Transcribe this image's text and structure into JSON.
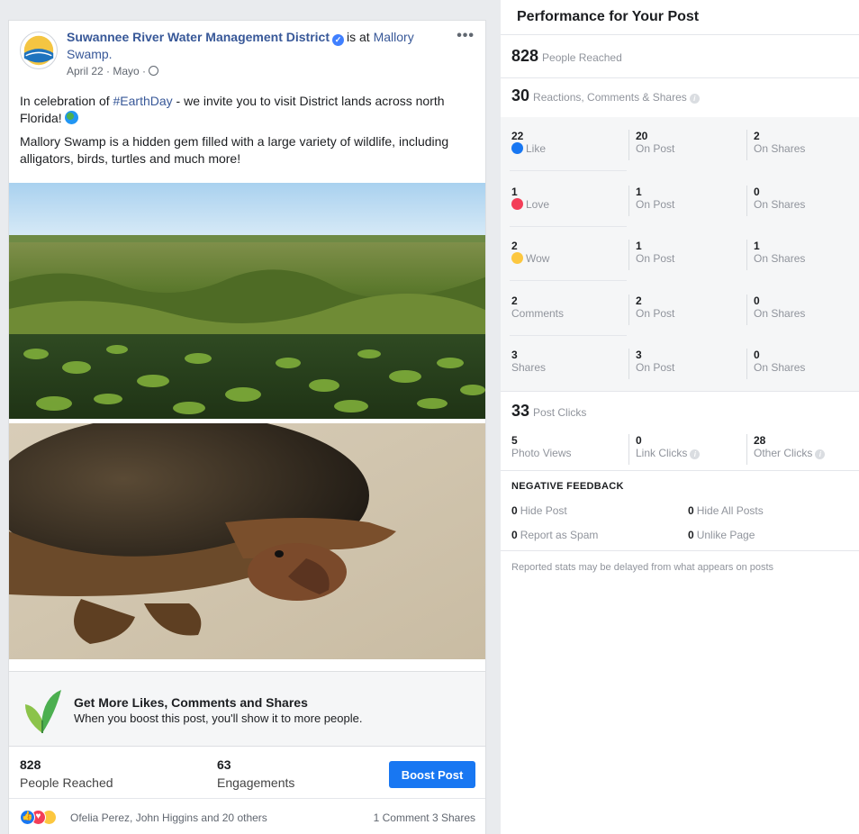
{
  "post": {
    "page_name": "Suwannee River Water Management District",
    "is_at": "is at",
    "location": "Mallory Swamp.",
    "date": "April 22",
    "author": "Mayo",
    "text_line1_prefix": "In celebration of ",
    "hashtag": "#EarthDay",
    "text_line1_suffix": " - we invite you to visit District lands across north Florida!",
    "text_line2": "Mallory Swamp is a hidden gem filled with a large variety of wildlife, including alligators, birds, turtles and much more!",
    "promo_title": "Get More Likes, Comments and Shares",
    "promo_sub": "When you boost this post, you'll show it to more people.",
    "people_reached_num": "828",
    "people_reached_lbl": "People Reached",
    "engagements_num": "63",
    "engagements_lbl": "Engagements",
    "boost_label": "Boost Post",
    "reaction_names": "Ofelia Perez, John Higgins and 20 others",
    "comments_shares": "1 Comment  3 Shares"
  },
  "performance": {
    "title": "Performance for Your Post",
    "reached_num": "828",
    "reached_lbl": "People Reached",
    "rcs_num": "30",
    "rcs_lbl": "Reactions, Comments & Shares",
    "rows": [
      {
        "total": "22",
        "label": "Like",
        "on_post": "20",
        "on_shares": "2"
      },
      {
        "total": "1",
        "label": "Love",
        "on_post": "1",
        "on_shares": "0"
      },
      {
        "total": "2",
        "label": "Wow",
        "on_post": "1",
        "on_shares": "1"
      },
      {
        "total": "2",
        "label": "Comments",
        "on_post": "2",
        "on_shares": "0"
      },
      {
        "total": "3",
        "label": "Shares",
        "on_post": "3",
        "on_shares": "0"
      }
    ],
    "on_post_lbl": "On Post",
    "on_shares_lbl": "On Shares",
    "clicks_num": "33",
    "clicks_lbl": "Post Clicks",
    "photo_views_num": "5",
    "photo_views_lbl": "Photo Views",
    "link_clicks_num": "0",
    "link_clicks_lbl": "Link Clicks",
    "other_clicks_num": "28",
    "other_clicks_lbl": "Other Clicks",
    "negative_title": "NEGATIVE FEEDBACK",
    "hide_post_num": "0",
    "hide_post_lbl": "Hide Post",
    "hide_all_num": "0",
    "hide_all_lbl": "Hide All Posts",
    "spam_num": "0",
    "spam_lbl": "Report as Spam",
    "unlike_num": "0",
    "unlike_lbl": "Unlike Page",
    "delay_note": "Reported stats may be delayed from what appears on posts"
  },
  "colors": {
    "accent": "#1877f2",
    "link": "#385898",
    "love": "#f33e58",
    "wow": "#fcc73f"
  }
}
